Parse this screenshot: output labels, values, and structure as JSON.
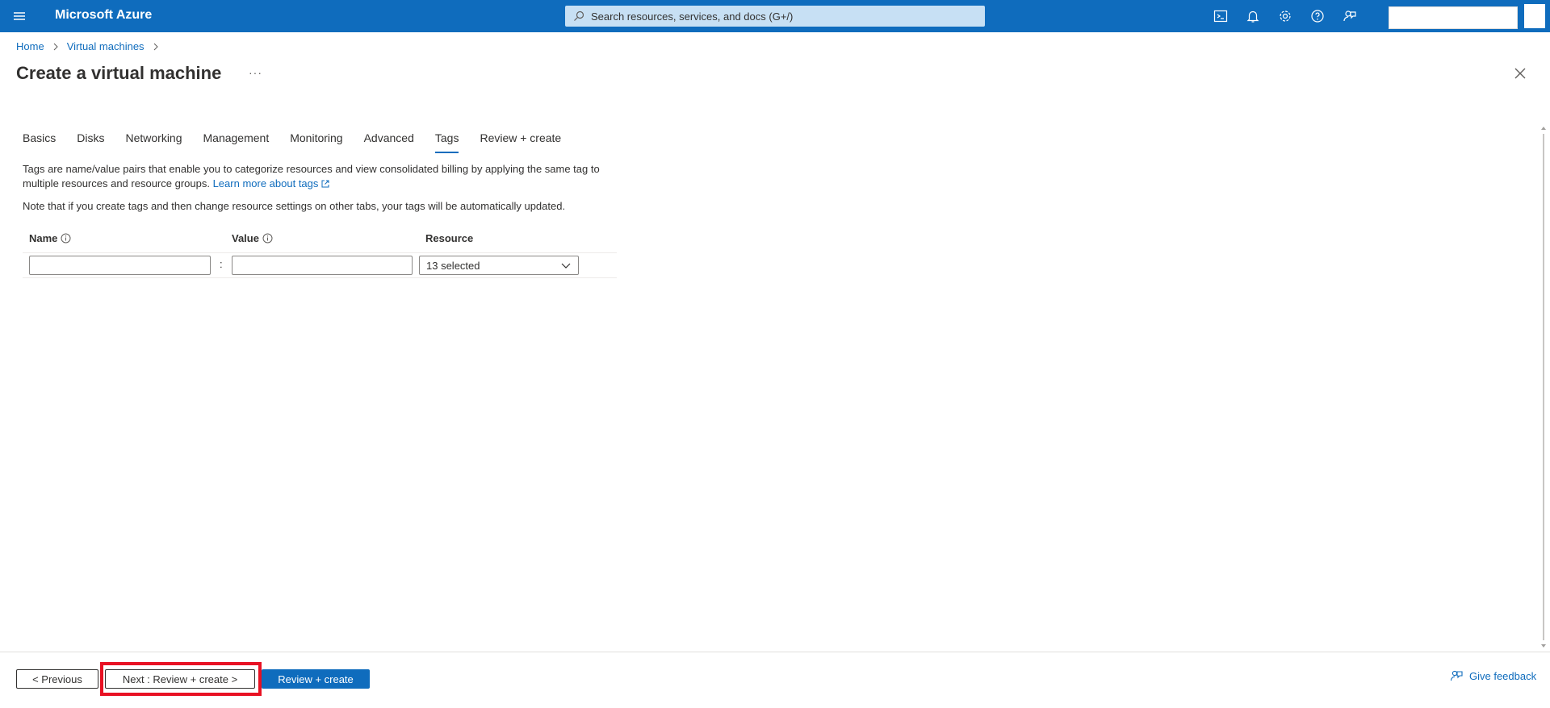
{
  "topbar": {
    "brand": "Microsoft Azure",
    "search_placeholder": "Search resources, services, and docs (G+/)",
    "icons": [
      "cloud-shell-icon",
      "notifications-icon",
      "settings-icon",
      "help-icon",
      "feedback-icon"
    ]
  },
  "breadcrumb": {
    "home": "Home",
    "virtual_machines": "Virtual machines"
  },
  "page": {
    "title": "Create a virtual machine",
    "more": "···"
  },
  "tabs": [
    {
      "label": "Basics"
    },
    {
      "label": "Disks"
    },
    {
      "label": "Networking"
    },
    {
      "label": "Management"
    },
    {
      "label": "Monitoring"
    },
    {
      "label": "Advanced"
    },
    {
      "label": "Tags",
      "active": true
    },
    {
      "label": "Review + create"
    }
  ],
  "content": {
    "description_text": "Tags are name/value pairs that enable you to categorize resources and view consolidated billing by applying the same tag to multiple resources and resource groups.",
    "learn_more": "Learn more about tags",
    "note": "Note that if you create tags and then change resource settings on other tabs, your tags will be automatically updated."
  },
  "tag_table": {
    "headers": {
      "name": "Name",
      "value": "Value",
      "resource": "Resource"
    },
    "row": {
      "name_value": "",
      "value_value": "",
      "separator": ":",
      "resource_selected": "13 selected"
    }
  },
  "footer": {
    "previous": "< Previous",
    "next": "Next : Review + create >",
    "review_create": "Review + create",
    "give_feedback": "Give feedback"
  },
  "colors": {
    "brand": "#0f6cbd",
    "search_bg": "#c7e0f4",
    "highlight": "#e81123"
  }
}
